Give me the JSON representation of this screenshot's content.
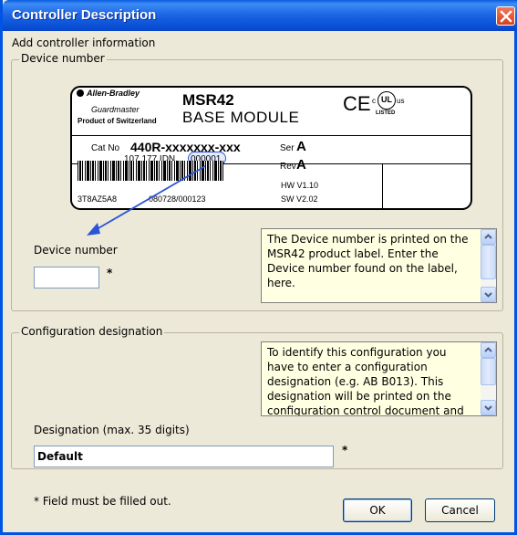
{
  "window": {
    "title": "Controller Description"
  },
  "intro_text": "Add controller information",
  "device_group": {
    "legend": "Device number",
    "field_label": "Device number",
    "value": "",
    "required_mark": "*",
    "tip": "The Device number is printed on the MSR42 product label. Enter the Device number found on the label, here."
  },
  "product_label": {
    "brand": "Allen-Bradley",
    "brand2": "Guardmaster",
    "origin": "Product of Switzerland",
    "model": "MSR42",
    "module": "BASE MODULE",
    "cert_ce": "CE",
    "cert_ul": "UL",
    "cert_ul_c": "c",
    "cert_ul_us": "us",
    "cert_listed": "LISTED",
    "catno_label": "Cat No",
    "catno": "440R-xxxxxxx-xxx",
    "ser_label": "Ser",
    "ser": "A",
    "rev_label": "Rev",
    "rev": "A",
    "code_line": "107 177 IDN.",
    "idn": "000001",
    "serial": "3T8AZ5A8",
    "date_code": "080728/000123",
    "hw": "HW V1.10",
    "sw": "SW V2.02"
  },
  "config_group": {
    "legend": "Configuration designation",
    "tip": "To identify this configuration you have to enter a configuration designation (e.g. AB B013). This designation will be printed on the configuration control document and",
    "field_label": "Designation (max. 35 digits)",
    "value": "Default",
    "required_mark": "*"
  },
  "footnote": "* Field  must be filled out.",
  "buttons": {
    "ok": "OK",
    "cancel": "Cancel"
  },
  "colors": {
    "titlebar": "#0a5be0",
    "dialog_bg": "#ece9d8",
    "tooltip_bg": "#ffffe1",
    "arrow": "#2b55d8"
  }
}
